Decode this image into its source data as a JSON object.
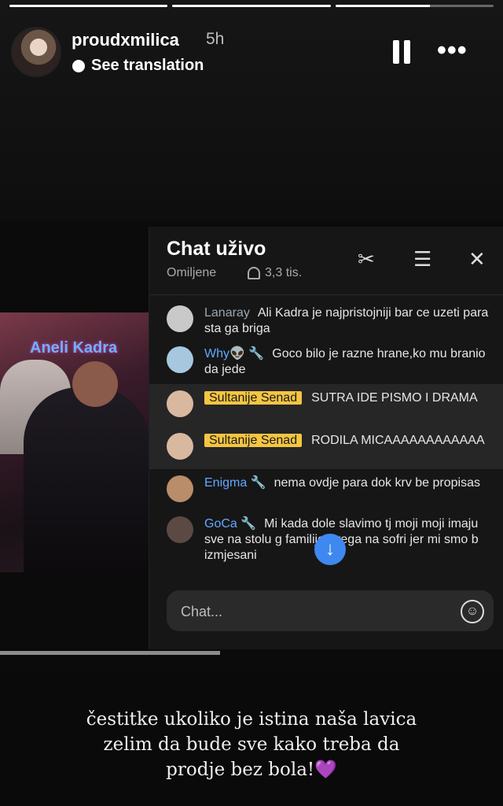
{
  "story": {
    "progress": [
      1.0,
      1.0,
      0.6
    ],
    "username": "proudxmilica",
    "time": "5h",
    "see_translation": "See translation",
    "pause_icon": "pause-icon",
    "more_icon": "more-icon"
  },
  "screenshot": {
    "video_overlay": "Aneli Kadra",
    "chat": {
      "title": "Chat uživo",
      "filter": "Omiljene",
      "viewers": "3,3 tis.",
      "messages": [
        {
          "name": "Lanaray",
          "text": "Ali Kadra je najpristojniji bar ce uzeti para sta ga briga"
        },
        {
          "name": "Why👽 🔧",
          "text": "Goco bilo je razne hrane,ko mu branio da jede"
        },
        {
          "name": "Sultanije Senad",
          "text": "SUTRA IDE PISMO I DRAMA"
        },
        {
          "name": "Sultanije Senad",
          "text": "RODILA MICAAAAAAAAAAAA"
        },
        {
          "name": "Enigma 🔧",
          "text": "nema ovdje para dok krv be propisas"
        },
        {
          "name": "GoCa 🔧",
          "text": "Mi kada dole slavimo tj moji moji imaju sve na stolu g familije svega na sofri jer mi smo b izmjesani"
        }
      ],
      "input_placeholder": "Chat..."
    }
  },
  "caption": {
    "line1": "čestitke ukoliko je istina naša lavica",
    "line2": "zelim da bude sve kako treba da",
    "line3": "prodje bez bola!",
    "heart": "💜"
  }
}
